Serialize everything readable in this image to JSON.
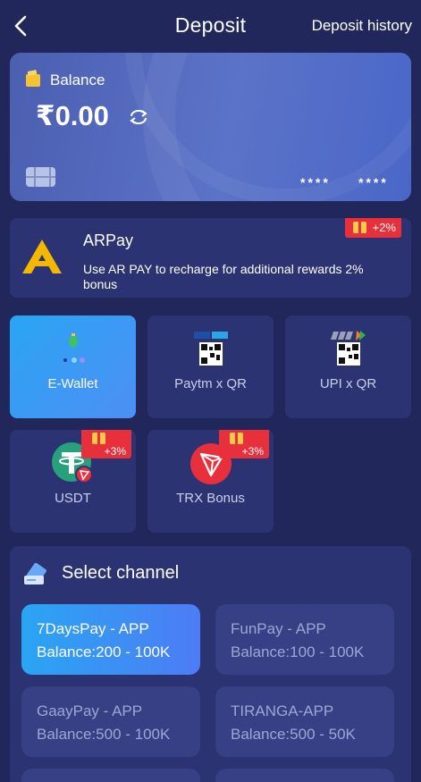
{
  "header": {
    "title": "Deposit",
    "history_label": "Deposit history"
  },
  "balance_card": {
    "label": "Balance",
    "amount": "₹0.00",
    "card_number_parts": [
      "****",
      "****"
    ]
  },
  "arpay": {
    "name": "ARPay",
    "description": "Use AR PAY to recharge for additional rewards 2% bonus",
    "bonus": "+2%"
  },
  "methods": [
    {
      "label": "E-Wallet",
      "active": true
    },
    {
      "label": "Paytm x QR",
      "active": false
    },
    {
      "label": "UPI x QR",
      "active": false
    },
    {
      "label": "USDT",
      "active": false,
      "bonus": "+3%"
    },
    {
      "label": "TRX Bonus",
      "active": false,
      "bonus": "+3%"
    }
  ],
  "channel_section": {
    "title": "Select channel",
    "channels": [
      {
        "name": "7DaysPay - APP",
        "balance": "Balance:200 - 100K",
        "active": true
      },
      {
        "name": "FunPay - APP",
        "balance": "Balance:100 - 100K",
        "active": false
      },
      {
        "name": "GaayPay - APP",
        "balance": "Balance:500 - 100K",
        "active": false
      },
      {
        "name": "TIRANGA-APP",
        "balance": "Balance:500 - 50K",
        "active": false
      }
    ]
  },
  "colors": {
    "background": "#22275b",
    "panel": "#2c3373",
    "accent": "#2aa5f3",
    "bonus_red": "#e8303c"
  },
  "icons": [
    "back-arrow-icon",
    "wallet-icon",
    "refresh-icon",
    "card-chip-icon",
    "arpay-logo",
    "gift-icon",
    "e-wallet-icon",
    "paytm-qr-icon",
    "upi-qr-icon",
    "usdt-icon",
    "trx-icon",
    "channel-card-icon"
  ]
}
